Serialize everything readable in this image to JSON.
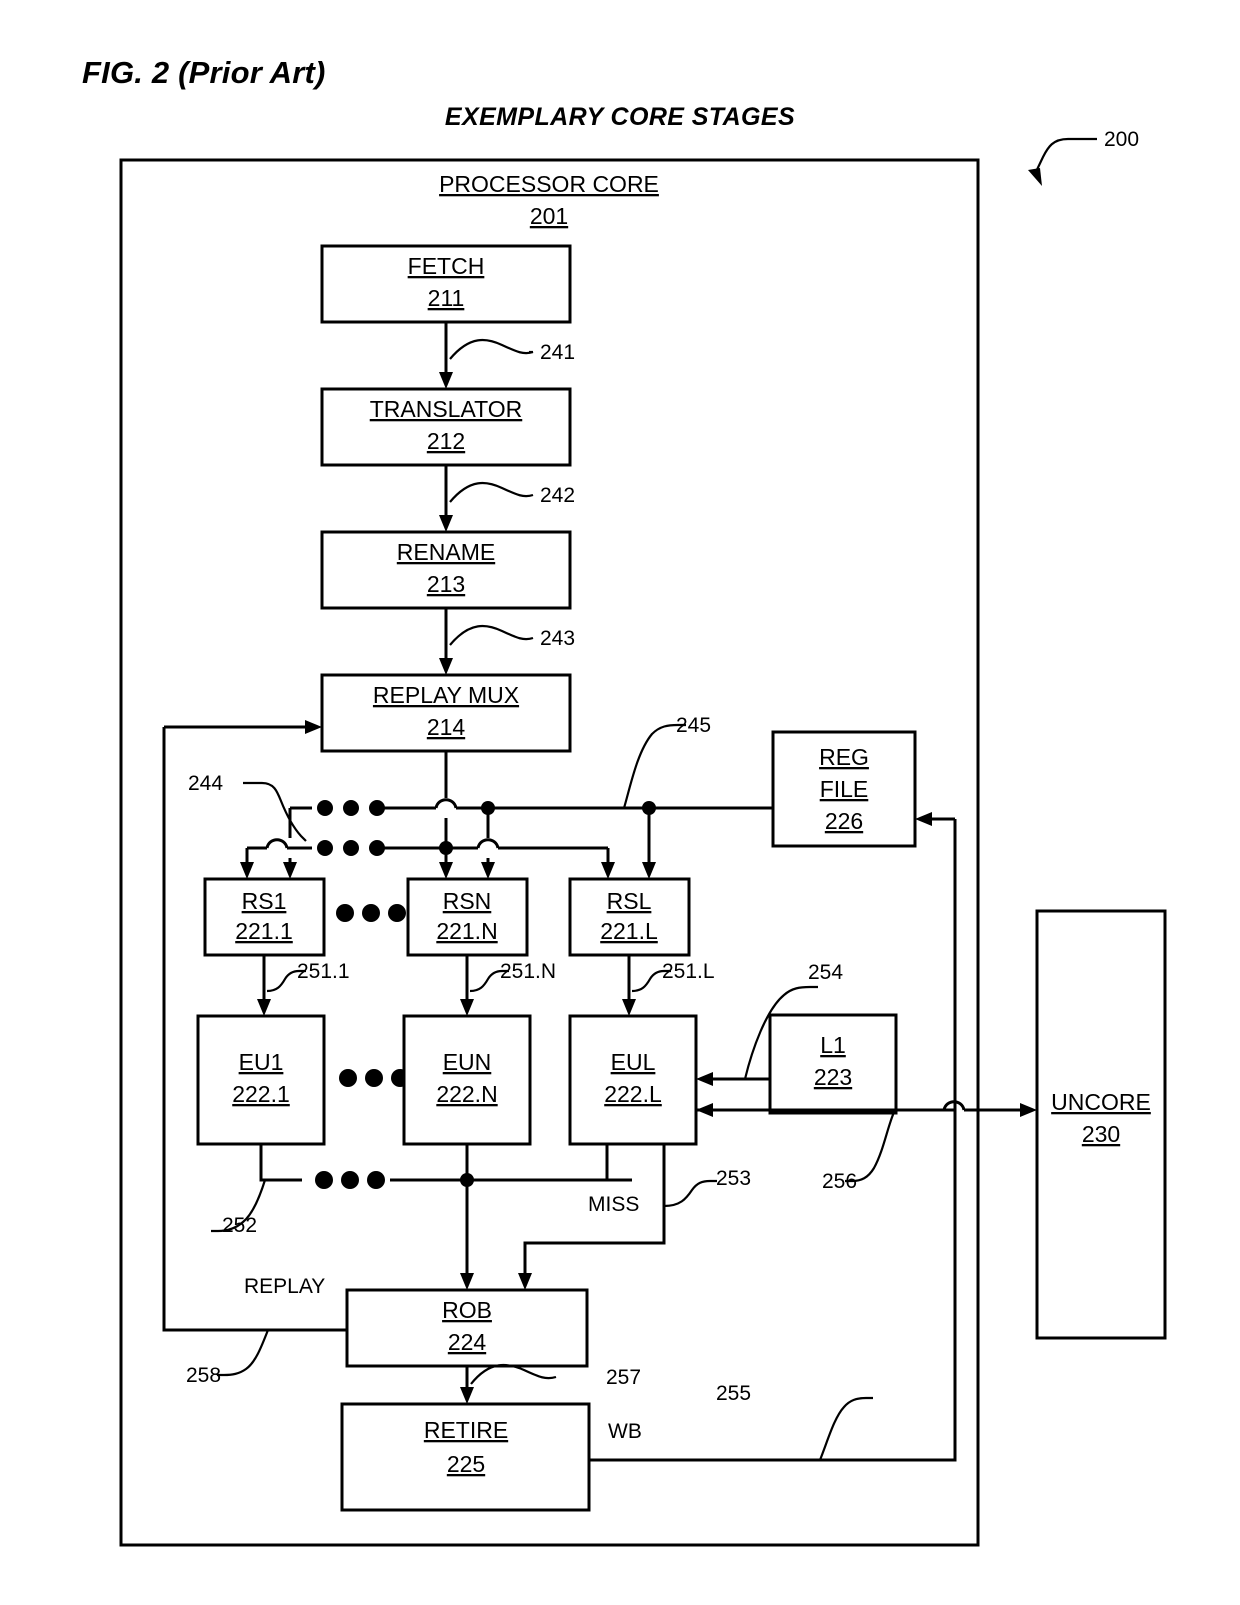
{
  "figure": {
    "label": "FIG. 2 (Prior Art)",
    "title": "EXEMPLARY CORE STAGES",
    "ref": "200"
  },
  "core": {
    "name": "PROCESSOR CORE",
    "ref": "201"
  },
  "blocks": {
    "fetch": {
      "name": "FETCH",
      "ref": "211"
    },
    "translator": {
      "name": "TRANSLATOR",
      "ref": "212"
    },
    "rename": {
      "name": "RENAME",
      "ref": "213"
    },
    "replay_mux": {
      "name": "REPLAY MUX",
      "ref": "214"
    },
    "rs1": {
      "name": "RS1",
      "ref": "221.1"
    },
    "rsn": {
      "name": "RSN",
      "ref": "221.N"
    },
    "rsl": {
      "name": "RSL",
      "ref": "221.L"
    },
    "eu1": {
      "name": "EU1",
      "ref": "222.1"
    },
    "eun": {
      "name": "EUN",
      "ref": "222.N"
    },
    "eul": {
      "name": "EUL",
      "ref": "222.L"
    },
    "l1": {
      "name": "L1",
      "ref": "223"
    },
    "rob": {
      "name": "ROB",
      "ref": "224"
    },
    "retire": {
      "name": "RETIRE",
      "ref": "225"
    },
    "reg_file": {
      "name_line1": "REG",
      "name_line2": "FILE",
      "ref": "226"
    },
    "uncore": {
      "name": "UNCORE",
      "ref": "230"
    }
  },
  "signals": {
    "s241": "241",
    "s242": "242",
    "s243": "243",
    "s244": "244",
    "s245": "245",
    "s251_1": "251.1",
    "s251_n": "251.N",
    "s251_l": "251.L",
    "s252": "252",
    "s253": "253",
    "s254": "254",
    "s255": "255",
    "s256": "256",
    "s257": "257",
    "s258": "258"
  },
  "labels": {
    "miss": "MISS",
    "replay": "REPLAY",
    "wb": "WB"
  },
  "colors": {
    "line": "#000000",
    "fill": "#ffffff"
  }
}
